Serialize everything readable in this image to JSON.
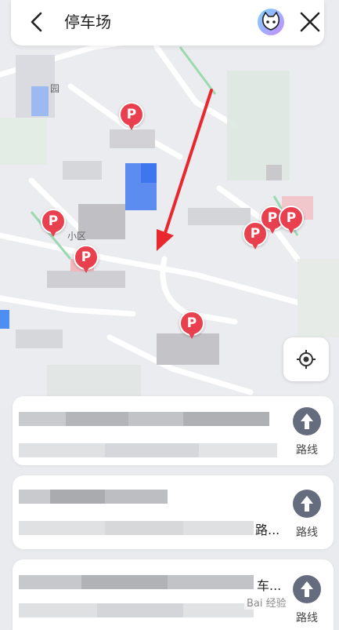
{
  "search": {
    "query": "停车场"
  },
  "map": {
    "parking_marker_label": "P",
    "labels": [
      "园",
      "小区"
    ],
    "annotation_arrow_color": "#e8272e",
    "marker_color": "#e8404f"
  },
  "results": [
    {
      "suffix": "",
      "route_label": "路线"
    },
    {
      "suffix": "路...",
      "route_label": "路线"
    },
    {
      "suffix": "车...",
      "route_label": "路线"
    }
  ],
  "watermark": "Bai 经验"
}
